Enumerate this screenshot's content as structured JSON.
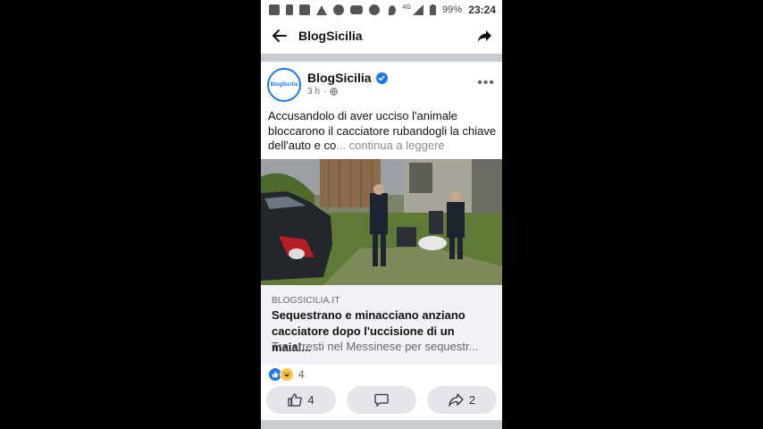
{
  "statusbar": {
    "network": "4G",
    "battery": "99%",
    "time": "23:24",
    "icons": [
      "message-icon",
      "upload-icon",
      "facebook-icon",
      "warning-icon",
      "messenger-icon",
      "youtube-icon",
      "chrome-icon",
      "location-icon",
      "signal-icon",
      "battery-icon"
    ]
  },
  "header": {
    "title": "BlogSicilia"
  },
  "post": {
    "author": "BlogSicilia",
    "avatar_text": "BlogSicilia",
    "time": "3 h",
    "text": "Accusandolo di aver ucciso l'animale bloccarono il cacciatore rubandogli la chiave dell'auto e co",
    "more_link": "... continua a leggere"
  },
  "link": {
    "domain": "BLOGSICILIA.IT",
    "headline": "Sequestrano e minacciano anziano cacciatore dopo l'uccisione di un maial...",
    "subline": "Tre arresti nel Messinese per sequestr..."
  },
  "reactions": {
    "count": "4"
  },
  "actions": {
    "like_count": "4",
    "share_count": "2"
  },
  "colors": {
    "accent": "#1877f2",
    "divider": "#c9ccd1",
    "card_bg": "#f0f2f5",
    "button_bg": "#e4e6eb"
  }
}
